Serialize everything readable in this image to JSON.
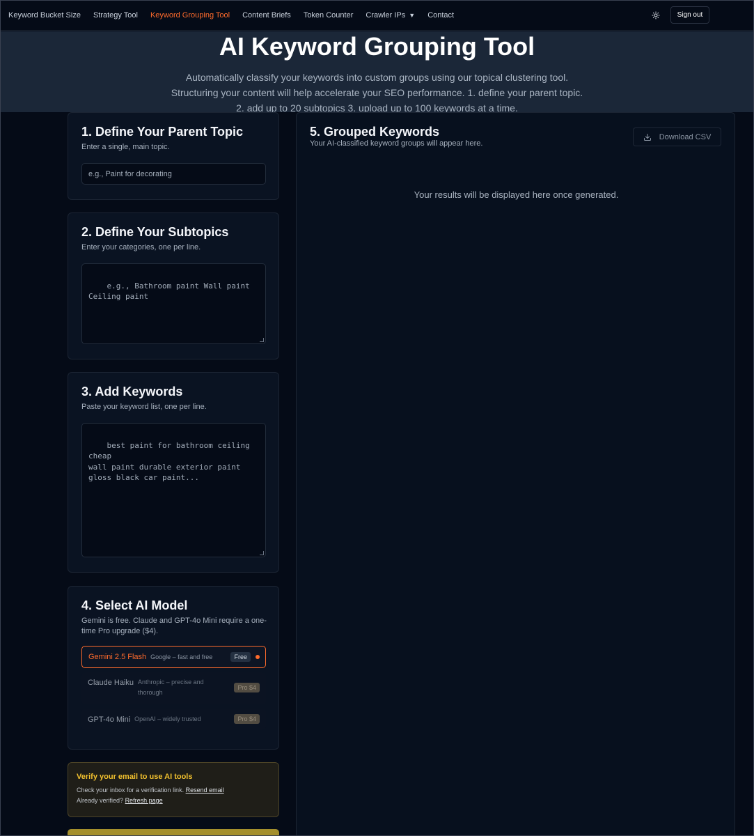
{
  "nav": {
    "links": [
      {
        "label": "Keyword Bucket Size"
      },
      {
        "label": "Strategy Tool"
      },
      {
        "label": "Keyword Grouping Tool"
      },
      {
        "label": "Content Briefs"
      },
      {
        "label": "Token Counter"
      },
      {
        "label": "Crawler IPs"
      },
      {
        "label": "Contact"
      }
    ],
    "active": "Keyword Grouping Tool",
    "caret": "▼",
    "theme_icon": "sun-icon",
    "signout_label": "Sign out"
  },
  "hero": {
    "title": "AI Keyword Grouping Tool",
    "description": "Automatically classify your keywords into custom groups using our topical clustering tool. Structuring your content will help accelerate your SEO performance. 1. define your parent topic. 2. add up to 20 subtopics 3. upload up to 100 keywords at a time."
  },
  "step1": {
    "title": "1. Define Your Parent Topic",
    "subtitle": "Enter a single, main topic.",
    "placeholder": "e.g., Paint for decorating"
  },
  "step2": {
    "title": "2. Define Your Subtopics",
    "subtitle": "Enter your categories, one per line.",
    "placeholder": "e.g., Bathroom paint Wall paint\nCeiling paint"
  },
  "step3": {
    "title": "3. Add Keywords",
    "subtitle": "Paste your keyword list, one per line.",
    "placeholder": "best paint for bathroom ceiling cheap\nwall paint durable exterior paint\ngloss black car paint..."
  },
  "step4": {
    "title": "4. Select AI Model",
    "subtitle": "Gemini is free. Claude and GPT-4o Mini require a one-time Pro upgrade ($4).",
    "models": [
      {
        "name": "Gemini 2.5 Flash",
        "desc": "Google – fast and free",
        "badge": "Free",
        "selected": true
      },
      {
        "name": "Claude Haiku",
        "desc": "Anthropic – precise and thorough",
        "badge": "Pro $4",
        "selected": false
      },
      {
        "name": "GPT-4o Mini",
        "desc": "OpenAI – widely trusted",
        "badge": "Pro $4",
        "selected": false
      }
    ]
  },
  "verify": {
    "title": "Verify your email to use AI tools",
    "line1": "Check your inbox for a verification link.",
    "resend": "Resend email",
    "line2": "Already verified?",
    "refresh": "Refresh page"
  },
  "results": {
    "title": "5. Grouped Keywords",
    "subtitle": "Your AI-classified keyword groups will appear here.",
    "download_label": "Download CSV",
    "placeholder": "Your results will be displayed here once generated."
  },
  "colors": {
    "accent": "#ff6b2c",
    "background": "#050b17",
    "hero_bg": "#1b2738",
    "warning": "#f2c12e"
  }
}
